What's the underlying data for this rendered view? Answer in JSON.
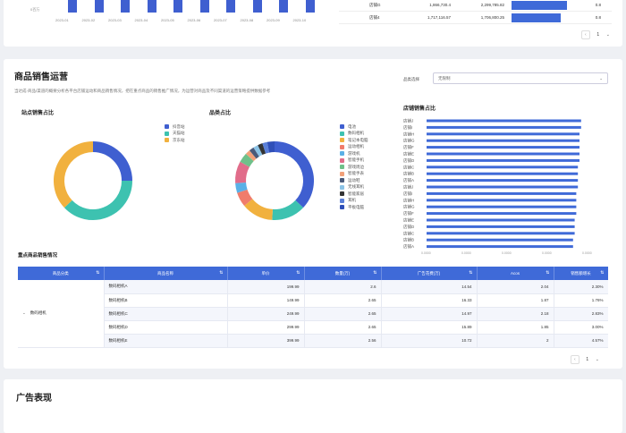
{
  "top_chart": {
    "y_label": "0百万",
    "months": [
      "2023-01",
      "2023-02",
      "2023-03",
      "2023-04",
      "2023-05",
      "2023-06",
      "2023-07",
      "2023-08",
      "2023-09",
      "2023-10"
    ],
    "bar_color": "#3f5fd0"
  },
  "top_table": {
    "rows": [
      {
        "store": "店铺G",
        "a": "1,866,730.4",
        "b": "2,299,785.82",
        "fill": 0.62,
        "right": "0.8"
      },
      {
        "store": "店铺4",
        "a": "1,717,116.57",
        "b": "1,706,800.25",
        "fill": 0.55,
        "right": "0.8"
      }
    ],
    "page": "1"
  },
  "section": {
    "title": "商品销售运营",
    "desc": "当达成-商品/渠道的概要分析各平台店铺运动和商品销售情况，把在重点商品的销售推广情况，为运营对商品及不同渠道的运营策略提供数据参考",
    "filter_label": "品类选择",
    "filter_value": "无限制"
  },
  "store_donut": {
    "title": "站点销售占比",
    "legend": [
      "抖音站",
      "天猫站",
      "京东站"
    ],
    "colors": [
      "#3f5fd0",
      "#3dc2b0",
      "#f1b13e"
    ],
    "values": [
      25,
      38,
      37
    ]
  },
  "category_donut": {
    "title": "品类占比",
    "legend": [
      "电池",
      "数码相机",
      "笔记本电脑",
      "运动相机",
      "游戏机",
      "智能手机",
      "游戏周边",
      "智能手表",
      "运动鞋",
      "无线耳机",
      "智能家居",
      "耳机",
      "平板电脑"
    ],
    "colors": [
      "#3f5fd0",
      "#3dc2b0",
      "#f1b13e",
      "#f07c6b",
      "#5ab0e6",
      "#e16c8a",
      "#6fc08a",
      "#f2a17a",
      "#4a5a7a",
      "#8bc3e6",
      "#333333",
      "#5a7fd8",
      "#2f4fb8"
    ],
    "values": [
      37,
      14,
      13,
      6,
      4,
      9,
      4,
      2,
      2,
      2,
      2,
      2,
      3
    ]
  },
  "store_bar": {
    "title": "店铺销售占比",
    "stores": [
      "店铺J",
      "店铺I",
      "店铺H",
      "店铺G",
      "店铺F",
      "店铺E",
      "店铺D",
      "店铺C",
      "店铺B",
      "店铺A",
      "店铺J",
      "店铺I",
      "店铺H",
      "店铺G",
      "店铺F",
      "店铺E",
      "店铺D",
      "店铺C",
      "店铺B",
      "店铺A"
    ],
    "values": [
      0.96,
      0.96,
      0.95,
      0.95,
      0.95,
      0.95,
      0.95,
      0.94,
      0.94,
      0.94,
      0.94,
      0.93,
      0.93,
      0.93,
      0.93,
      0.92,
      0.92,
      0.92,
      0.91,
      0.91
    ],
    "xticks": [
      "0.0000",
      "0.0000",
      "0.0000",
      "0.0000",
      "0.0000"
    ]
  },
  "key_table": {
    "title": "重点商品销售情况",
    "headers": [
      "商品分类",
      "商品名称",
      "单价",
      "数量(万)",
      "广告花费(万)",
      "Acos",
      "销售额增长"
    ],
    "group": "数码相机",
    "rows": [
      [
        "数码相机A",
        "199.99",
        "2.6",
        "14.54",
        "2.04",
        "2.30%"
      ],
      [
        "数码相机B",
        "149.99",
        "2.65",
        "16.33",
        "1.87",
        "1.76%"
      ],
      [
        "数码相机C",
        "249.99",
        "2.65",
        "14.97",
        "2.18",
        "2.83%"
      ],
      [
        "数码相机D",
        "299.99",
        "2.65",
        "15.89",
        "1.85",
        "3.00%"
      ],
      [
        "数码相机E",
        "399.99",
        "2.56",
        "10.72",
        "2",
        "4.57%"
      ]
    ],
    "page": "1"
  },
  "ad_section": {
    "title": "广告表现"
  }
}
